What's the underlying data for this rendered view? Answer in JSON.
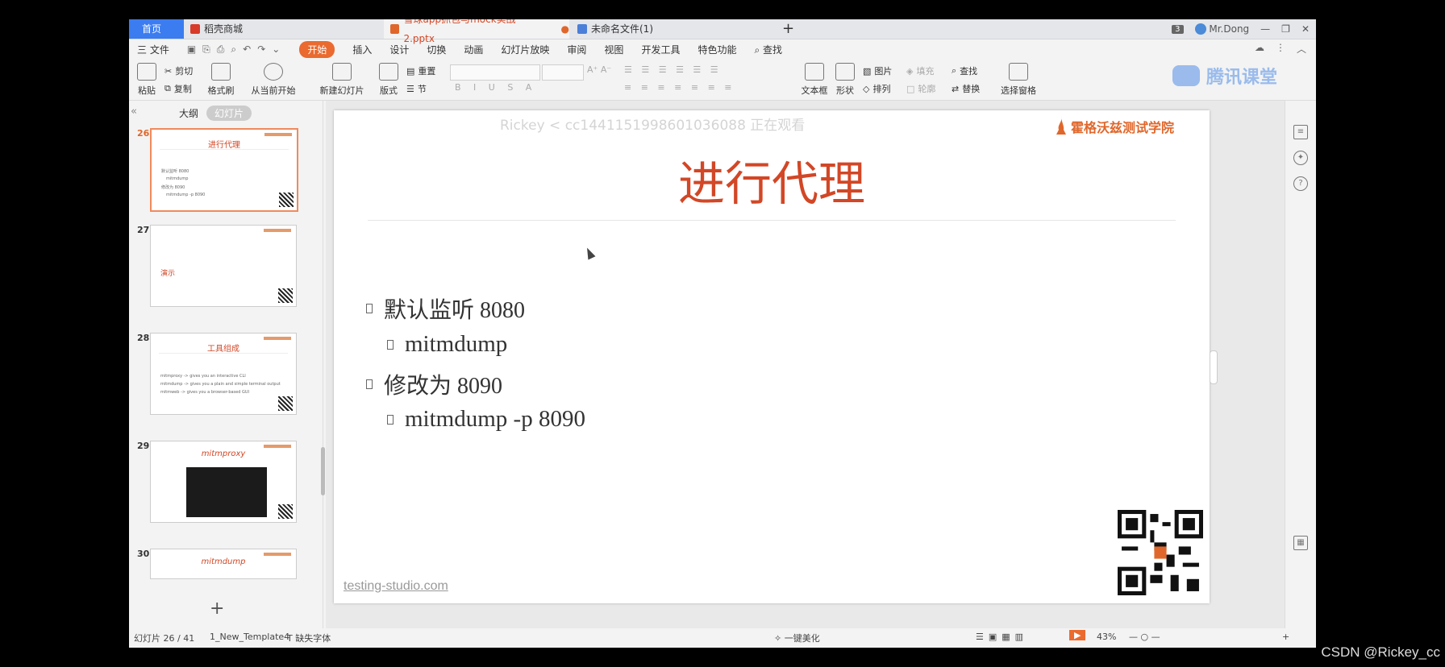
{
  "tabs": {
    "home": "首页",
    "daoke": "稻壳商城",
    "pptx": "雪球app抓包与mock实战2.pptx",
    "untitled": "未命名文件(1)",
    "new": "+"
  },
  "titlebar_right": {
    "badge": "3",
    "user": "Mr.Dong"
  },
  "menu": {
    "file": "三 文件",
    "items": [
      "开始",
      "插入",
      "设计",
      "切换",
      "动画",
      "幻灯片放映",
      "审阅",
      "视图",
      "开发工具",
      "特色功能"
    ],
    "search": "查找"
  },
  "ribbon": {
    "paste": "粘贴",
    "cut": "剪切",
    "copy": "复制",
    "format_painter": "格式刷",
    "from_current": "从当前开始",
    "new_slide": "新建幻灯片",
    "layout": "版式",
    "reset": "重置",
    "section": "节",
    "textbox": "文本框",
    "shape": "形状",
    "picture": "图片",
    "fill": "填充",
    "find": "查找",
    "arrange": "排列",
    "outline": "轮廓",
    "replace": "替换",
    "select_pane": "选择窗格",
    "font_styles": "B I U S A",
    "font_size_buttons": "A⁺ A⁻"
  },
  "overlay": {
    "viewer_note": "Rickey < cc1441151998601036088 正在观看",
    "tengxun": "腾讯课堂"
  },
  "left_panel": {
    "outline_tab": "大纲",
    "slides_tab": "幻灯片",
    "add": "+",
    "thumbs": [
      {
        "num": "26",
        "title": "进行代理",
        "lines": [
          "默认监听 8080",
          "mitmdump",
          "修改为 8090",
          "mitmdump -p 8090"
        ]
      },
      {
        "num": "27",
        "title": "",
        "tag": "演示",
        "lines": []
      },
      {
        "num": "28",
        "title": "工具组成",
        "lines": [
          "mitmproxy -> gives you an interactive CLI",
          "mitmdump -> gives you a plain and simple terminal output",
          "mitmweb -> gives you a browser-based GUI"
        ]
      },
      {
        "num": "29",
        "title": "mitmproxy",
        "lines": []
      },
      {
        "num": "30",
        "title": "mitmdump",
        "lines": []
      }
    ]
  },
  "slide": {
    "brand": "霍格沃兹测试学院",
    "title": "进行代理",
    "bullets": [
      {
        "level": 1,
        "text": "默认监听 8080"
      },
      {
        "level": 2,
        "text": "mitmdump"
      },
      {
        "level": 1,
        "text": "修改为 8090"
      },
      {
        "level": 2,
        "text": "mitmdump -p 8090"
      }
    ],
    "footer": "testing-studio.com"
  },
  "status": {
    "slide_counter": "幻灯片 26 / 41",
    "template": "1_New_Template4",
    "missing_font": "缺失字体",
    "beautify": "一键美化",
    "zoom": "43%"
  },
  "watermark": "CSDN @Rickey_cc",
  "colors": {
    "accent": "#d24726",
    "home_tab": "#3b7cf0",
    "start_btn": "#ea6a2f"
  }
}
